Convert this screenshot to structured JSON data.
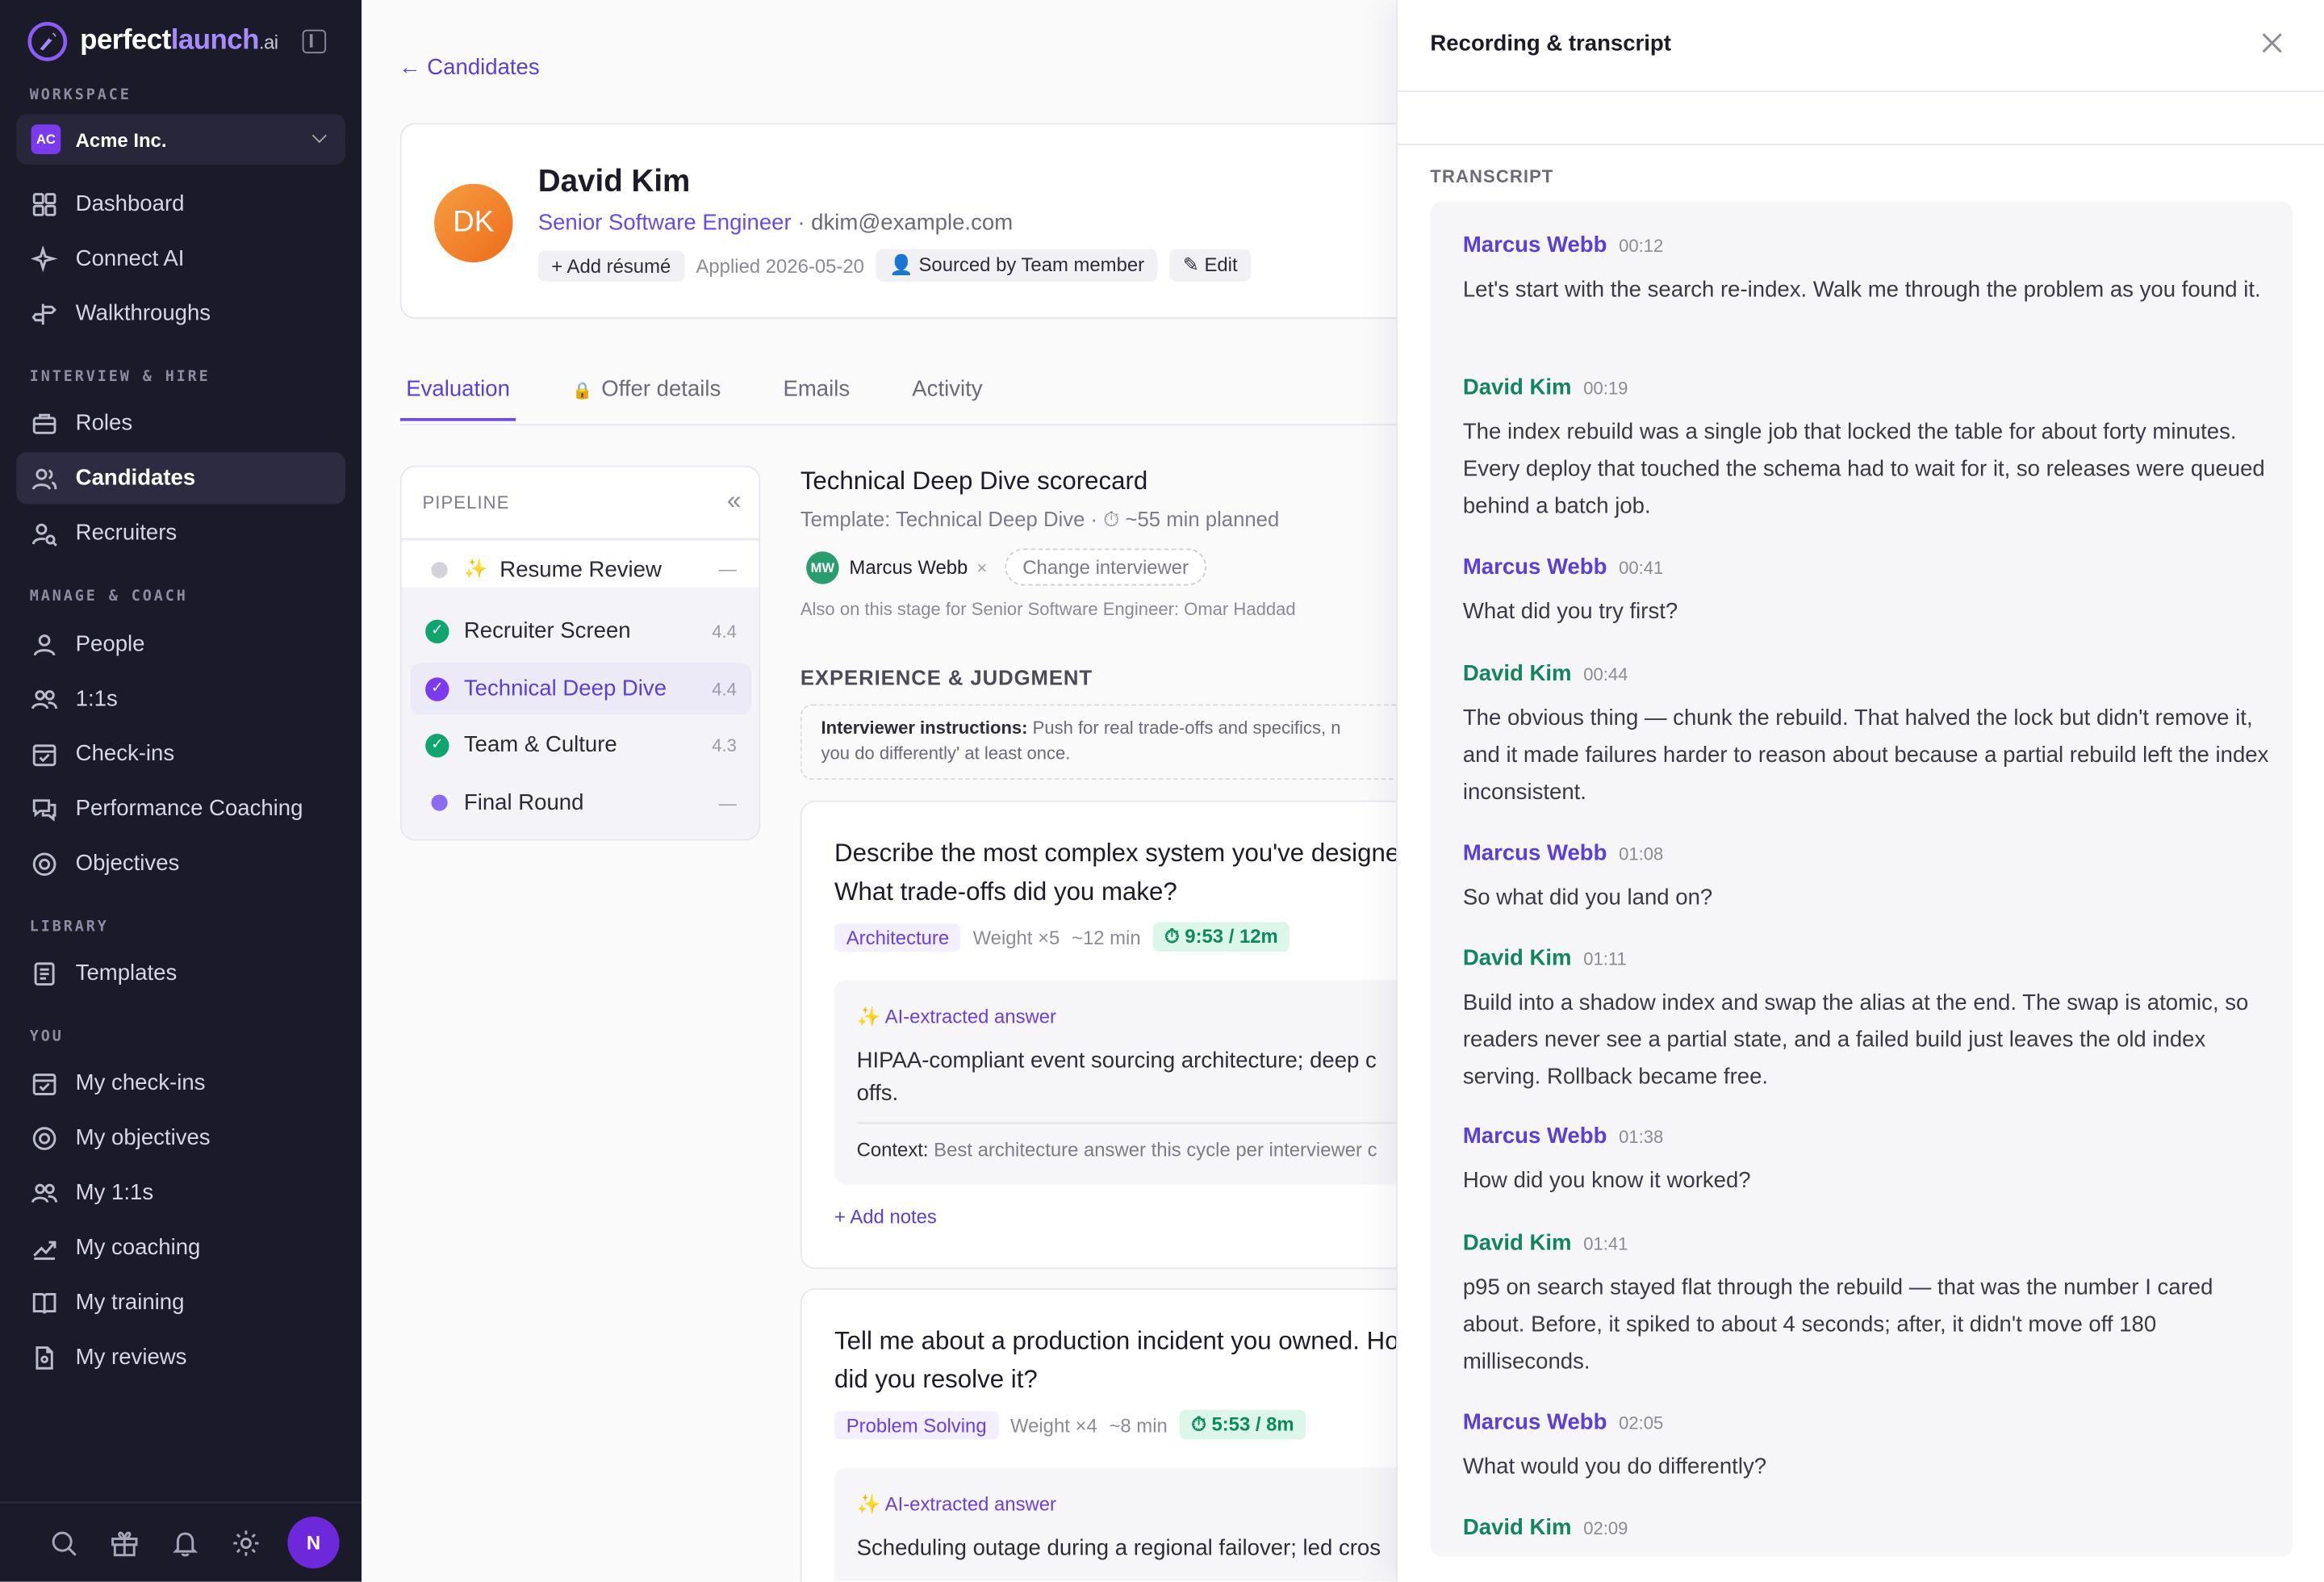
{
  "brand": {
    "name_a": "perfect",
    "name_b": "launch",
    "name_c": ".ai"
  },
  "workspace": {
    "section": "WORKSPACE",
    "badge": "AC",
    "name": "Acme Inc."
  },
  "sidebar": {
    "top_items": [
      {
        "label": "Dashboard",
        "icon": "grid-icon"
      },
      {
        "label": "Connect AI",
        "icon": "sparkle-icon"
      },
      {
        "label": "Walkthroughs",
        "icon": "signpost-icon"
      }
    ],
    "section_hire": "INTERVIEW & HIRE",
    "hire_items": [
      {
        "label": "Roles",
        "icon": "briefcase-icon"
      },
      {
        "label": "Candidates",
        "icon": "users-icon"
      },
      {
        "label": "Recruiters",
        "icon": "user-search-icon"
      }
    ],
    "section_manage": "MANAGE & COACH",
    "manage_items": [
      {
        "label": "People",
        "icon": "user-icon"
      },
      {
        "label": "1:1s",
        "icon": "users-icon"
      },
      {
        "label": "Check-ins",
        "icon": "calendar-check-icon"
      },
      {
        "label": "Performance Coaching",
        "icon": "chat-icon"
      },
      {
        "label": "Objectives",
        "icon": "target-icon"
      }
    ],
    "section_library": "LIBRARY",
    "library_items": [
      {
        "label": "Templates",
        "icon": "template-icon"
      }
    ],
    "section_you": "YOU",
    "you_items": [
      {
        "label": "My check-ins",
        "icon": "calendar-check-icon"
      },
      {
        "label": "My objectives",
        "icon": "target-icon"
      },
      {
        "label": "My 1:1s",
        "icon": "users-icon"
      },
      {
        "label": "My coaching",
        "icon": "trend-icon"
      },
      {
        "label": "My training",
        "icon": "book-icon"
      },
      {
        "label": "My reviews",
        "icon": "file-icon"
      }
    ],
    "user_initial": "N"
  },
  "main": {
    "back_link": "← Candidates",
    "candidate": {
      "initials": "DK",
      "name": "David Kim",
      "role": "Senior Software Engineer",
      "email": " · dkim@example.com",
      "add_resume": "+ Add résumé",
      "applied": "Applied 2026-05-20",
      "sourced": "👤 Sourced by Team member",
      "edit": "✎ Edit"
    },
    "tabs": [
      "Evaluation",
      "Offer details",
      "Emails",
      "Activity"
    ],
    "pipeline": {
      "title": "PIPELINE",
      "collapse": "«",
      "stages": [
        {
          "label": "Resume Review",
          "score": "—"
        },
        {
          "label": "Recruiter Screen",
          "score": "4.4"
        },
        {
          "label": "Technical Deep Dive",
          "score": "4.4"
        },
        {
          "label": "Team & Culture",
          "score": "4.3"
        },
        {
          "label": "Final Round",
          "score": "—"
        }
      ]
    },
    "scorecard": {
      "title": "Technical Deep Dive scorecard",
      "template": "Template: Technical Deep Dive · ⏱ ~55 min planned",
      "interviewer_initials": "MW",
      "interviewer": "Marcus Webb",
      "remove": "×",
      "change_btn": "Change interviewer",
      "also": "Also on this stage for Senior Software Engineer: Omar Haddad",
      "section": "EXPERIENCE & JUDGMENT",
      "instr_label": "Interviewer instructions:",
      "instr_text": " Push for real trade-offs and specifics, n",
      "instr_text2": "you do differently' at least once.",
      "questions": [
        {
          "text": "Describe the most complex system you've designed. What trade-offs did you make?",
          "tag": "Architecture",
          "weight": "Weight ×5",
          "duration": "~12 min",
          "timer": "⏱ 9:53 / 12m",
          "ai_label": "✨ AI-extracted answer",
          "answer_l1": "HIPAA-compliant event sourcing architecture; deep c",
          "answer_l2": "offs.",
          "context_label": "Context:",
          "context": " Best architecture answer this cycle per interviewer c",
          "add_notes": "+ Add notes"
        },
        {
          "text": "Tell me about a production incident you owned. How did you resolve it?",
          "tag": "Problem Solving",
          "weight": "Weight ×4",
          "duration": "~8 min",
          "timer": "⏱ 5:53 / 8m",
          "ai_label": "✨ AI-extracted answer",
          "answer_l1": "Scheduling outage during a regional failover; led cros"
        }
      ]
    }
  },
  "panel": {
    "title": "Recording & transcript",
    "section": "TRANSCRIPT",
    "turns": [
      {
        "speaker": "Marcus Webb",
        "time": "00:12",
        "text": "Let's start with the search re-index. Walk me through the problem as you found it."
      },
      {
        "speaker": "David Kim",
        "time": "00:19",
        "text": "The index rebuild was a single job that locked the table for about forty minutes. Every deploy that touched the schema had to wait for it, so releases were queued behind a batch job."
      },
      {
        "speaker": "Marcus Webb",
        "time": "00:41",
        "text": "What did you try first?"
      },
      {
        "speaker": "David Kim",
        "time": "00:44",
        "text": "The obvious thing — chunk the rebuild. That halved the lock but didn't remove it, and it made failures harder to reason about because a partial rebuild left the index inconsistent."
      },
      {
        "speaker": "Marcus Webb",
        "time": "01:08",
        "text": "So what did you land on?"
      },
      {
        "speaker": "David Kim",
        "time": "01:11",
        "text": "Build into a shadow index and swap the alias at the end. The swap is atomic, so readers never see a partial state, and a failed build just leaves the old index serving. Rollback became free."
      },
      {
        "speaker": "Marcus Webb",
        "time": "01:38",
        "text": "How did you know it worked?"
      },
      {
        "speaker": "David Kim",
        "time": "01:41",
        "text": "p95 on search stayed flat through the rebuild — that was the number I cared about. Before, it spiked to about 4 seconds; after, it didn't move off 180 milliseconds."
      },
      {
        "speaker": "Marcus Webb",
        "time": "02:05",
        "text": "What would you do differently?"
      },
      {
        "speaker": "David Kim",
        "time": "02:09",
        "text": ""
      }
    ]
  }
}
